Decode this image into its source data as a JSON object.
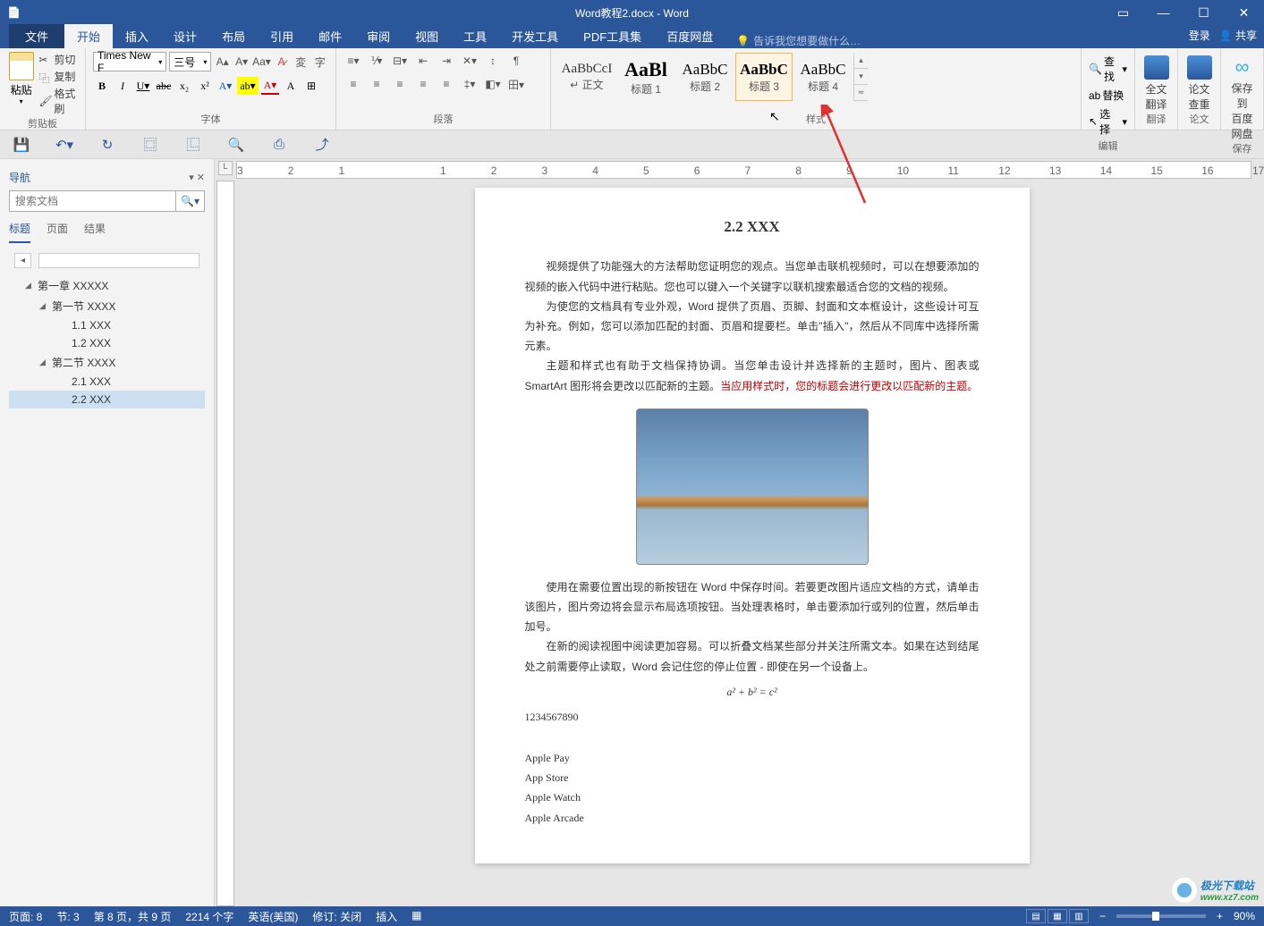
{
  "title": "Word教程2.docx - Word",
  "tabs": {
    "file": "文件",
    "home": "开始",
    "insert": "插入",
    "design": "设计",
    "layout": "布局",
    "references": "引用",
    "mailings": "邮件",
    "review": "审阅",
    "view": "视图",
    "tools": "工具",
    "dev": "开发工具",
    "pdf": "PDF工具集",
    "baidu": "百度网盘"
  },
  "tell_me_placeholder": "告诉我您想要做什么…",
  "login": "登录",
  "share": "共享",
  "clipboard": {
    "paste": "粘贴",
    "cut": "剪切",
    "copy": "复制",
    "format_painter": "格式刷",
    "label": "剪贴板"
  },
  "font": {
    "name": "Times New F",
    "size": "三号",
    "label": "字体"
  },
  "paragraph": {
    "label": "段落"
  },
  "styles": {
    "label": "样式",
    "items": [
      {
        "preview": "AaBbCcI",
        "name": "↵ 正文",
        "cls": ""
      },
      {
        "preview": "AaBl",
        "name": "标题 1",
        "cls": "h1"
      },
      {
        "preview": "AaBbC",
        "name": "标题 2",
        "cls": "h2"
      },
      {
        "preview": "AaBbC",
        "name": "标题 3",
        "cls": "h3"
      },
      {
        "preview": "AaBbC",
        "name": "标题 4",
        "cls": "h4"
      }
    ]
  },
  "edit": {
    "find": "查找",
    "replace": "替换",
    "select": "选择",
    "label": "编辑"
  },
  "translate": {
    "line1": "全文",
    "line2": "翻译",
    "label": "翻译"
  },
  "paper": {
    "line1": "论文",
    "line2": "查重",
    "label": "论文"
  },
  "save_baidu": {
    "line1": "保存到",
    "line2": "百度网盘",
    "label": "保存"
  },
  "nav": {
    "title": "导航",
    "search_placeholder": "搜索文档",
    "tabs": {
      "headings": "标题",
      "pages": "页面",
      "results": "结果"
    },
    "items": [
      {
        "depth": 1,
        "text": "第一章 XXXXX",
        "tri": "◢"
      },
      {
        "depth": 2,
        "text": "第一节 XXXX",
        "tri": "◢"
      },
      {
        "depth": 3,
        "text": "1.1 XXX",
        "tri": ""
      },
      {
        "depth": 3,
        "text": "1.2 XXX",
        "tri": ""
      },
      {
        "depth": 2,
        "text": "第二节 XXXX",
        "tri": "◢"
      },
      {
        "depth": 3,
        "text": "2.1 XXX",
        "tri": ""
      },
      {
        "depth": 3,
        "text": "2.2 XXX",
        "tri": "",
        "selected": true
      }
    ]
  },
  "doc": {
    "heading": "2.2 XXX",
    "p1": "视频提供了功能强大的方法帮助您证明您的观点。当您单击联机视频时，可以在想要添加的视频的嵌入代码中进行粘贴。您也可以键入一个关键字以联机搜索最适合您的文档的视频。",
    "p2": "为使您的文档具有专业外观，Word 提供了页眉、页脚、封面和文本框设计，这些设计可互为补充。例如，您可以添加匹配的封面、页眉和提要栏。单击\"插入\"，然后从不同库中选择所需元素。",
    "p3a": "主题和样式也有助于文档保持协调。当您单击设计并选择新的主题时，图片、图表或 SmartArt 图形将会更改以匹配新的主题。",
    "p3b": "当应用样式时，您的标题会进行更改以匹配新的主题。",
    "p4": "使用在需要位置出现的新按钮在 Word 中保存时间。若要更改图片适应文档的方式，请单击该图片，图片旁边将会显示布局选项按钮。当处理表格时，单击要添加行或列的位置，然后单击加号。",
    "p5": "在新的阅读视图中阅读更加容易。可以折叠文档某些部分并关注所需文本。如果在达到结尾处之前需要停止读取，Word 会记住您的停止位置 - 即使在另一个设备上。",
    "eq": "a² + b² = c²",
    "nums": "1234567890",
    "l1": "Apple Pay",
    "l2": "App Store",
    "l3": "Apple Watch",
    "l4": "Apple Arcade"
  },
  "status": {
    "page": "页面: 8",
    "section": "节: 3",
    "pages": "第 8 页，共 9 页",
    "words": "2214 个字",
    "lang": "英语(美国)",
    "track": "修订: 关闭",
    "insert": "插入",
    "zoom": "90%"
  },
  "ruler_h": [
    "3",
    "2",
    "1",
    "",
    "1",
    "2",
    "3",
    "4",
    "5",
    "6",
    "7",
    "8",
    "9",
    "10",
    "11",
    "12",
    "13",
    "14",
    "15",
    "16",
    "17"
  ],
  "watermark": {
    "text": "极光下载站",
    "url": "www.xz7.com"
  }
}
